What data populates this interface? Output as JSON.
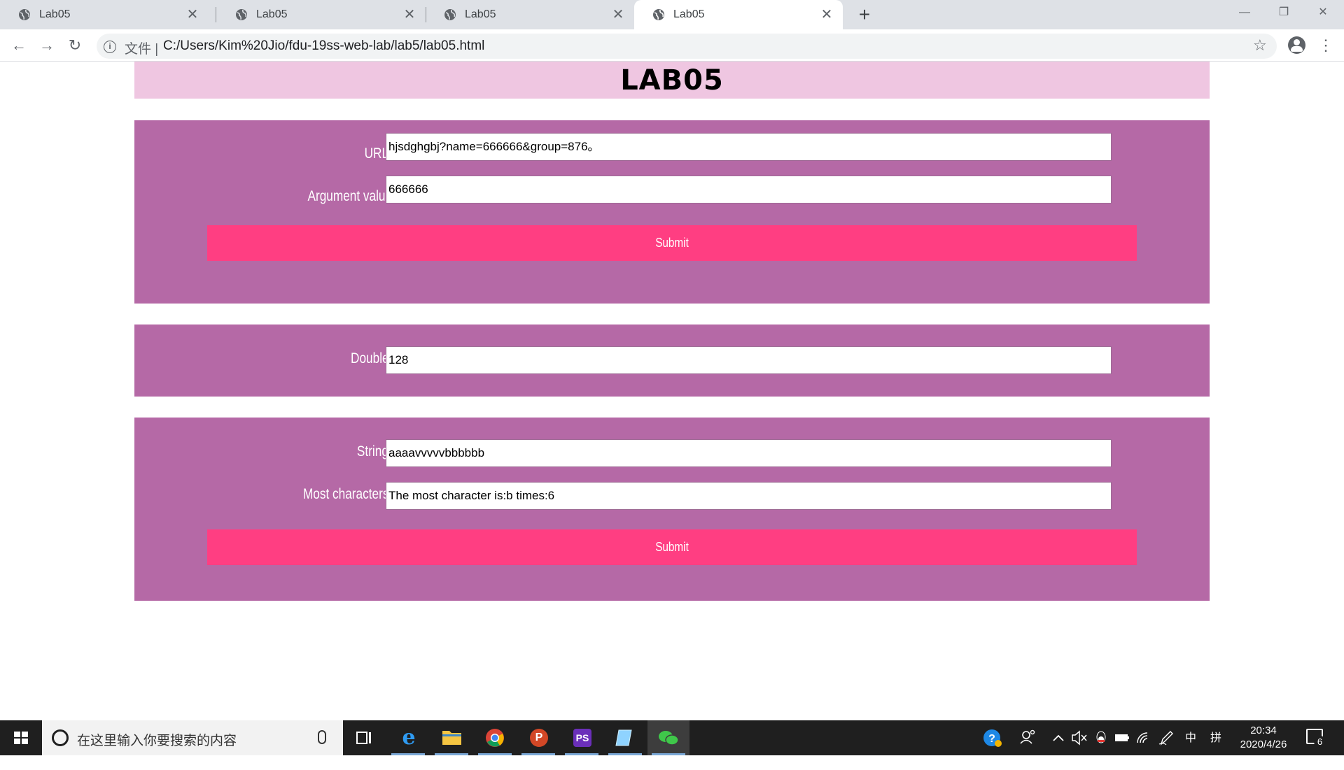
{
  "browser": {
    "tabs": [
      {
        "title": "Lab05",
        "active": false
      },
      {
        "title": "Lab05",
        "active": false
      },
      {
        "title": "Lab05",
        "active": false
      },
      {
        "title": "Lab05",
        "active": true
      }
    ],
    "close_glyph": "✕",
    "new_tab_glyph": "+",
    "window_controls": {
      "minimize": "—",
      "restore": "❐",
      "close": "✕"
    },
    "nav": {
      "back": "←",
      "forward": "→",
      "reload": "↻"
    },
    "address": {
      "info_glyph": "i",
      "scheme_label": "文件 |",
      "url": "C:/Users/Kim%20Jio/fdu-19ss-web-lab/lab5/lab05.html"
    },
    "star_glyph": "☆",
    "menu_glyph": "⋮"
  },
  "page": {
    "heading": "LAB05",
    "panel1": {
      "url_label": "URL:",
      "url_value": "hjsdghgbj?name=666666&group=876。",
      "argument_label": "Argument value",
      "argument_value": "666666",
      "submit_label": "Submit"
    },
    "panel2": {
      "double_label": "Double:",
      "double_value": "128"
    },
    "panel3": {
      "string_label": "String:",
      "string_value": "aaaavvvvvbbbbbb",
      "most_label": "Most characters:",
      "most_value": "The most character is:b times:6",
      "submit_label": "Submit"
    },
    "colors": {
      "title_bg": "#efc6e1",
      "panel_bg": "#b569a6",
      "submit_bg": "#ff3e82"
    }
  },
  "taskbar": {
    "search_placeholder": "在这里输入你要搜索的内容",
    "apps": [
      "task-view",
      "edge",
      "file-explorer",
      "chrome",
      "powerpoint",
      "phpstorm",
      "notepad",
      "wechat"
    ],
    "tray": {
      "ime_lang": "中",
      "ime_mode": "拼"
    },
    "clock": {
      "time": "20:34",
      "date": "2020/4/26"
    },
    "notification_count": "6"
  }
}
